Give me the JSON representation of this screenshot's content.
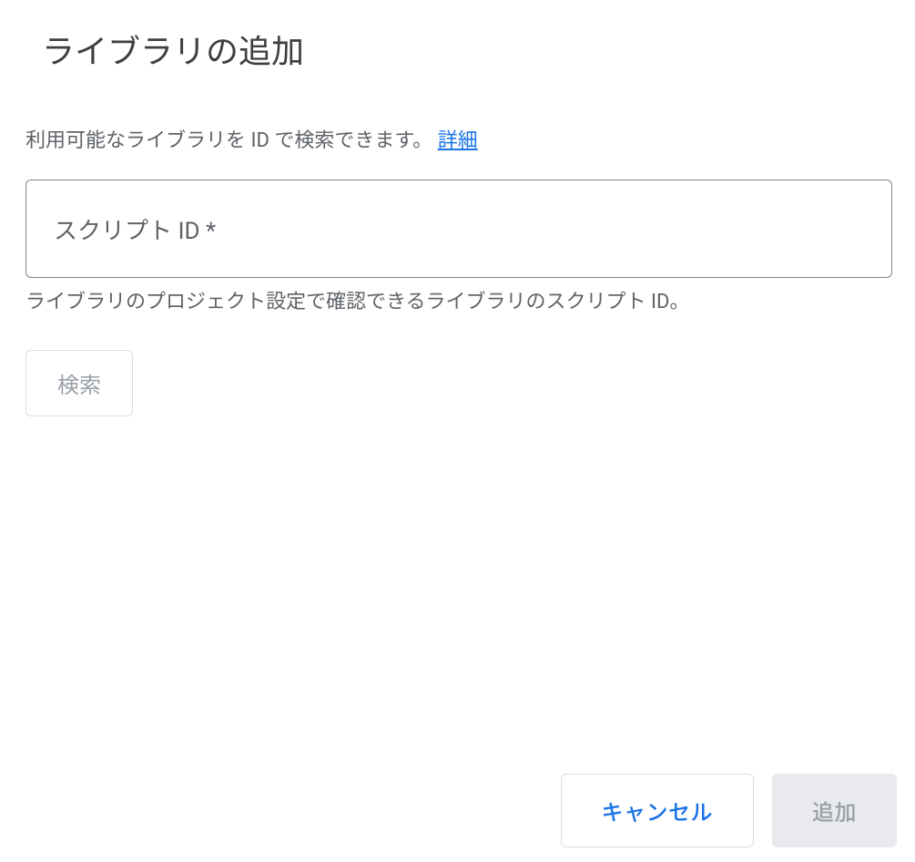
{
  "dialog": {
    "title": "ライブラリの追加",
    "descriptionPrefix": "利用可能なライブラリを ID で検索できます。",
    "detailsLink": "詳細",
    "inputPlaceholder": "スクリプト ID *",
    "helperText": "ライブラリのプロジェクト設定で確認できるライブラリのスクリプト ID。",
    "searchButton": "検索",
    "cancelButton": "キャンセル",
    "addButton": "追加"
  }
}
